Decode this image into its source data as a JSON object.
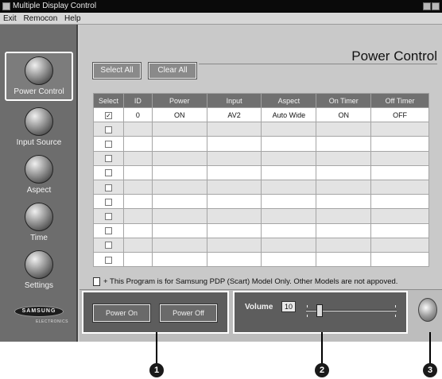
{
  "window": {
    "title": "Multiple Display Control"
  },
  "menu": {
    "items": [
      "Exit",
      "Remocon",
      "Help"
    ]
  },
  "sidebar": {
    "items": [
      {
        "label": "Power Control",
        "icon": "power-icon",
        "active": true
      },
      {
        "label": "Input Source",
        "icon": "plug-icon",
        "active": false
      },
      {
        "label": "Aspect",
        "icon": "aspect-icon",
        "active": false
      },
      {
        "label": "Time",
        "icon": "clock-icon",
        "active": false
      },
      {
        "label": "Settings",
        "icon": "settings-icon",
        "active": false
      }
    ],
    "logo": {
      "brand": "SAMSUNG",
      "sub": "ELECTRONICS"
    }
  },
  "page": {
    "title": "Power Control"
  },
  "toolbar": {
    "select_all": "Select All",
    "clear_all": "Clear All"
  },
  "table": {
    "columns": [
      "Select",
      "ID",
      "Power",
      "Input",
      "Aspect",
      "On Timer",
      "Off Timer"
    ],
    "rows": [
      {
        "checked": true,
        "id": "0",
        "power": "ON",
        "input": "AV2",
        "aspect": "Auto Wide",
        "on_timer": "ON",
        "off_timer": "OFF"
      },
      {
        "checked": false,
        "id": "",
        "power": "",
        "input": "",
        "aspect": "",
        "on_timer": "",
        "off_timer": ""
      },
      {
        "checked": false,
        "id": "",
        "power": "",
        "input": "",
        "aspect": "",
        "on_timer": "",
        "off_timer": ""
      },
      {
        "checked": false,
        "id": "",
        "power": "",
        "input": "",
        "aspect": "",
        "on_timer": "",
        "off_timer": ""
      },
      {
        "checked": false,
        "id": "",
        "power": "",
        "input": "",
        "aspect": "",
        "on_timer": "",
        "off_timer": ""
      },
      {
        "checked": false,
        "id": "",
        "power": "",
        "input": "",
        "aspect": "",
        "on_timer": "",
        "off_timer": ""
      },
      {
        "checked": false,
        "id": "",
        "power": "",
        "input": "",
        "aspect": "",
        "on_timer": "",
        "off_timer": ""
      },
      {
        "checked": false,
        "id": "",
        "power": "",
        "input": "",
        "aspect": "",
        "on_timer": "",
        "off_timer": ""
      },
      {
        "checked": false,
        "id": "",
        "power": "",
        "input": "",
        "aspect": "",
        "on_timer": "",
        "off_timer": ""
      },
      {
        "checked": false,
        "id": "",
        "power": "",
        "input": "",
        "aspect": "",
        "on_timer": "",
        "off_timer": ""
      },
      {
        "checked": false,
        "id": "",
        "power": "",
        "input": "",
        "aspect": "",
        "on_timer": "",
        "off_timer": ""
      }
    ]
  },
  "note": {
    "text": "+ This Program is for Samsung PDP (Scart) Model Only.  Other Models are not appoved."
  },
  "power": {
    "on_label": "Power On",
    "off_label": "Power Off"
  },
  "volume": {
    "label": "Volume",
    "value": "10",
    "level_fraction": 0.12
  },
  "callouts": [
    "1",
    "2",
    "3"
  ],
  "colors": {
    "sidebar_bg": "#6d6d6d",
    "header_bg": "#707070",
    "panel_bg": "#5d5d5d"
  }
}
